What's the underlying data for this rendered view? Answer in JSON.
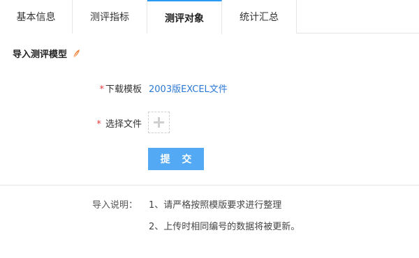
{
  "tabs": [
    {
      "label": "基本信息",
      "active": false
    },
    {
      "label": "测评指标",
      "active": false
    },
    {
      "label": "测评对象",
      "active": true
    },
    {
      "label": "统计汇总",
      "active": false
    }
  ],
  "section": {
    "title": "导入测评模型",
    "icon": "feather-icon"
  },
  "form": {
    "required_mark": "*",
    "download_label": "下载模板",
    "download_link": "2003版EXCEL文件",
    "file_label": "选择文件",
    "file_icon": "plus-icon",
    "submit_label": "提 交"
  },
  "notes": {
    "label": "导入说明：",
    "lines": [
      "1、请严格按照模版要求进行整理",
      "2、上传时相同编号的数据将被更新。"
    ]
  },
  "colors": {
    "accent": "#2b9af3",
    "link": "#2b78d4",
    "button": "#53a9f4",
    "required": "#e4393c",
    "feather": "#f0843a"
  }
}
